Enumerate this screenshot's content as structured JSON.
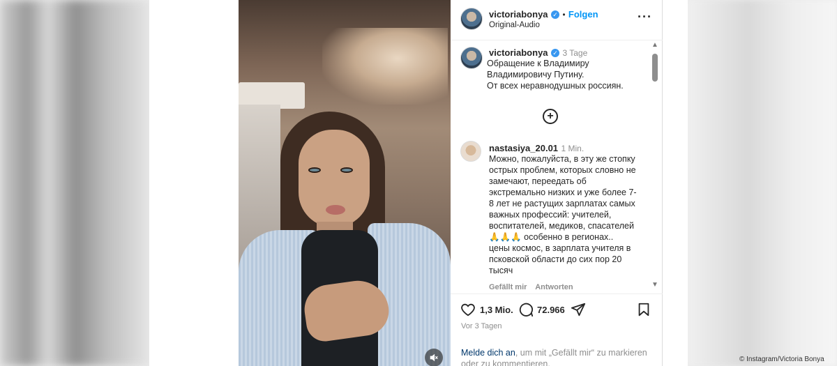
{
  "header": {
    "username": "victoriabonya",
    "verified_icon": "verified-badge-icon",
    "separator": "•",
    "follow_label": "Folgen",
    "audio_label": "Original-Audio",
    "more_icon": "more-options-icon"
  },
  "caption": {
    "username": "victoriabonya",
    "time": "3 Tage",
    "lines": [
      "Обращение к Владимиру",
      "Владимировичу Путину.",
      "От всех неравнодушных россиян."
    ]
  },
  "load_more_icon": "plus-circle-icon",
  "comment": {
    "username": "nastasiya_20.01",
    "time": "1 Min.",
    "lines": [
      "Можно, пожалуйста, в эту же стопку",
      "острых проблем, которых словно не",
      "замечают, переедать об",
      "экстремально низких и уже более 7-",
      "8 лет не растущих зарплатах самых",
      "важных профессий: учителей,",
      "воспитателей, медиков, спасателей",
      "🙏🙏🙏 особенно в регионах..",
      "цены космос, в зарплата учителя в",
      "псковской области до сих пор 20",
      "тысяч"
    ],
    "like_label": "Gefällt mir",
    "reply_label": "Antworten"
  },
  "actions": {
    "like_icon": "heart-icon",
    "likes_count": "1,3 Mio.",
    "comment_icon": "comment-icon",
    "comments_count": "72.966",
    "share_icon": "share-icon",
    "save_icon": "bookmark-icon"
  },
  "posted_ago": "Vor 3 Tagen",
  "login_prompt": {
    "link": "Melde dich an",
    "rest": ", um mit „Gefällt mir“ zu markieren oder zu kommentieren."
  },
  "video": {
    "mute_icon": "muted-speaker-icon"
  },
  "credit": "© Instagram/Victoria Bonya",
  "colors": {
    "link_blue": "#0095f6",
    "text": "#262626",
    "secondary": "#8e8e8e"
  }
}
